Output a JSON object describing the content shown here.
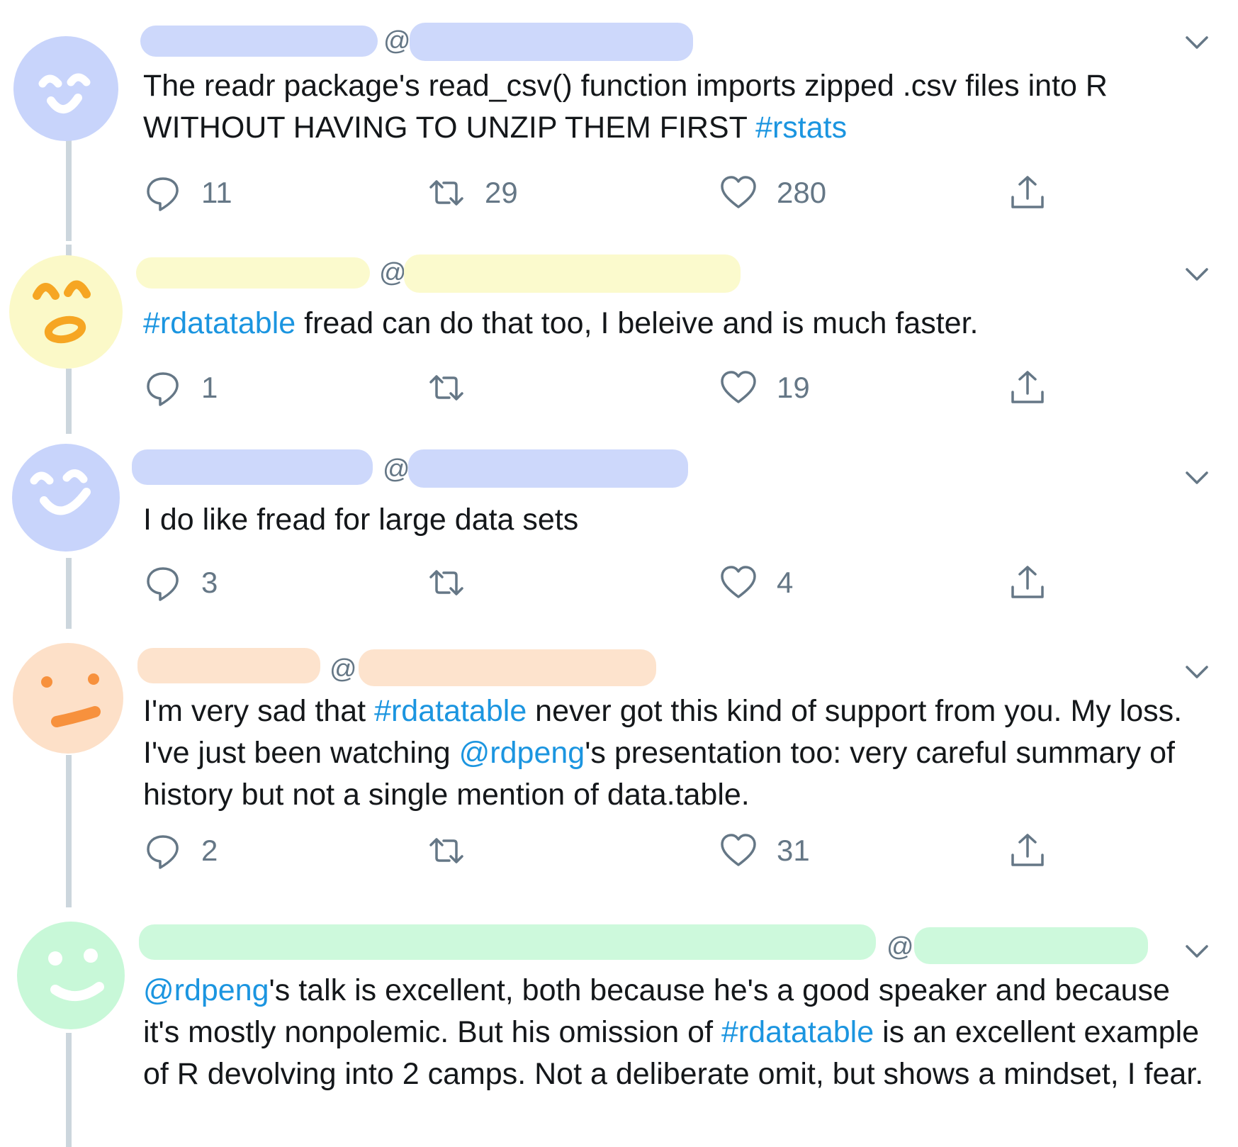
{
  "tweets": [
    {
      "avatar_color": "#c8d4fb",
      "redact_color": "#c8d4fb",
      "at": "@",
      "segments": [
        {
          "text": "The readr package's read_csv() function imports zipped .csv files into R WITHOUT HAVING TO UNZIP THEM FIRST ",
          "link": false
        },
        {
          "text": "#rstats",
          "link": true
        }
      ],
      "reply_count": "11",
      "retweet_count": "29",
      "like_count": "280"
    },
    {
      "avatar_color": "#fbf9c8",
      "redact_color": "#fbfac8",
      "at": "@",
      "segments": [
        {
          "text": "#rdatatable",
          "link": true
        },
        {
          "text": " fread can do that too, I beleive and is much faster.",
          "link": false
        }
      ],
      "reply_count": "1",
      "retweet_count": "",
      "like_count": "19"
    },
    {
      "avatar_color": "#c8d4fb",
      "redact_color": "#c8d4fb",
      "at": "@",
      "segments": [
        {
          "text": "I do like fread for large data sets",
          "link": false
        }
      ],
      "reply_count": "3",
      "retweet_count": "",
      "like_count": "4"
    },
    {
      "avatar_color": "#fde0c8",
      "redact_color": "#fde0c8",
      "at": "@",
      "segments": [
        {
          "text": "I'm very sad that ",
          "link": false
        },
        {
          "text": "#rdatatable",
          "link": true
        },
        {
          "text": " never got this kind of support from you. My loss. I've just been watching ",
          "link": false
        },
        {
          "text": "@rdpeng",
          "link": true
        },
        {
          "text": "'s presentation too: very careful summary of history but not a single mention of data.table.",
          "link": false
        }
      ],
      "reply_count": "2",
      "retweet_count": "",
      "like_count": "31"
    },
    {
      "avatar_color": "#c8f8d8",
      "redact_color": "#c8f8d8",
      "at": "@",
      "segments": [
        {
          "text": "@rdpeng",
          "link": true
        },
        {
          "text": "'s talk is excellent, both because he's a good speaker and because it's mostly nonpolemic. But his omission of ",
          "link": false
        },
        {
          "text": "#rdatatable",
          "link": true
        },
        {
          "text": " is an excellent example of R devolving into 2 camps. Not a deliberate omit, but shows a mindset, I fear.",
          "link": false
        }
      ]
    }
  ],
  "colors": {
    "text": "#14171a",
    "link": "#1b95e0",
    "muted": "#657786",
    "thread_line": "#ccd6dd"
  }
}
